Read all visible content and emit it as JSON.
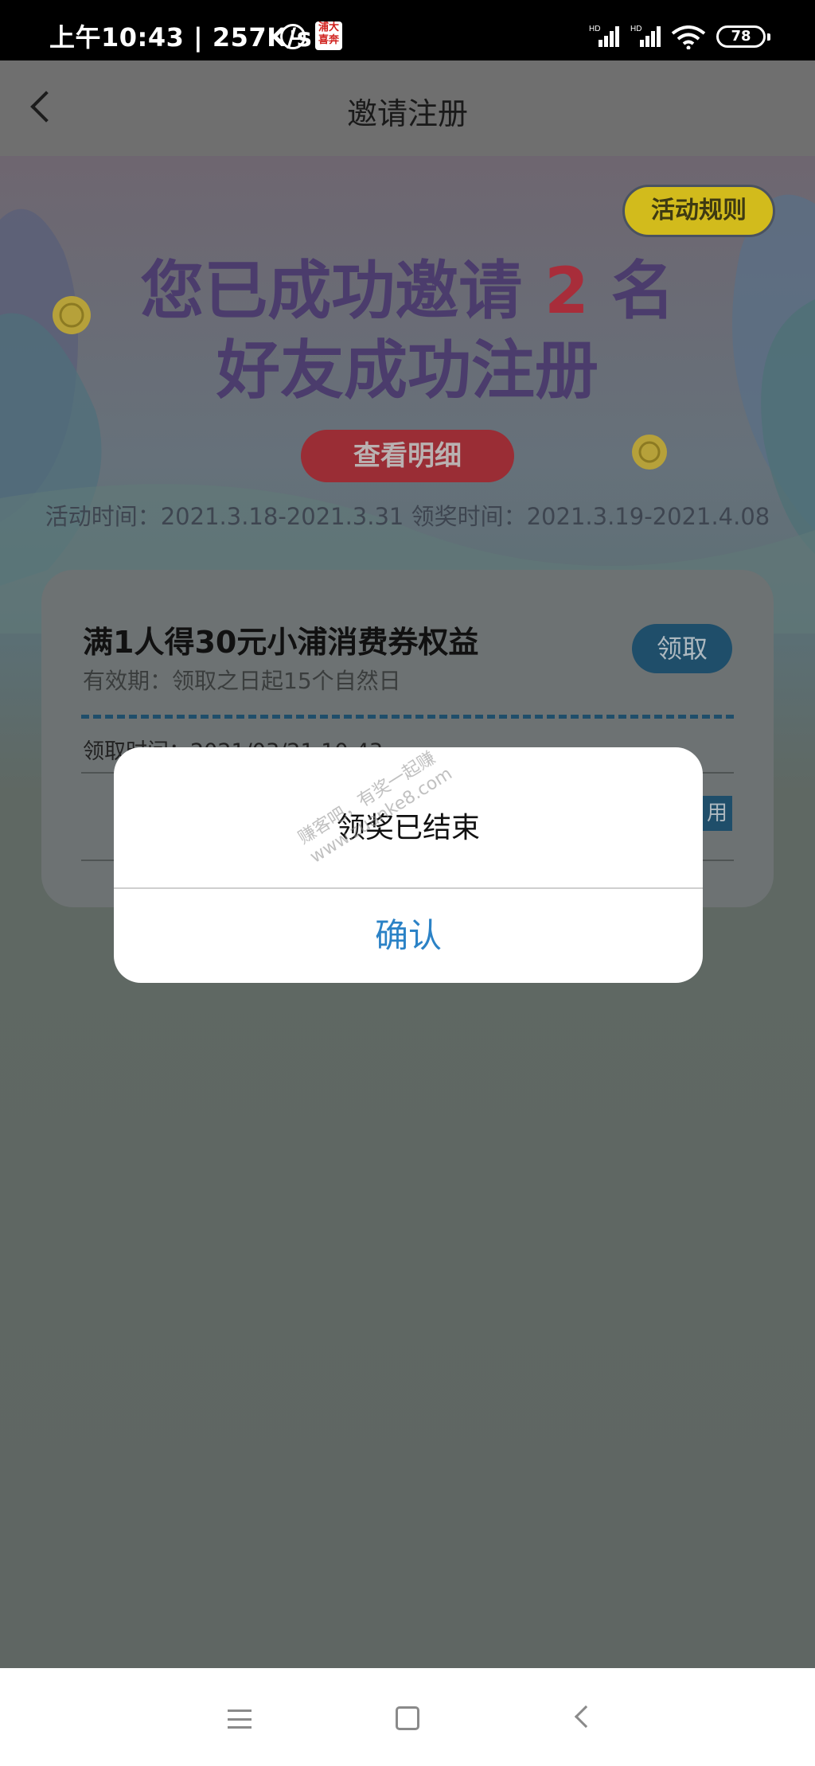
{
  "status_bar": {
    "time_speed": "上午10:43 | 257K/s",
    "app_badge": "浦大喜奔",
    "signal_label": "HD",
    "battery": "78"
  },
  "header": {
    "title": "邀请注册"
  },
  "banner": {
    "rules_button": "活动规则",
    "headline_line1_prefix": "您已成功邀请",
    "headline_count": "2",
    "headline_line1_suffix": "名",
    "headline_line2": "好友成功注册",
    "detail_button": "查看明细",
    "period_text": "活动时间：2021.3.18-2021.3.31 领奖时间：2021.3.19-2021.4.08"
  },
  "reward": {
    "title": "满1人得30元小浦消费券权益",
    "validity": "有效期：领取之日起15个自然日",
    "claim_button": "领取",
    "record_text": "领取时间：2021/03/21 10:43",
    "used_button": "用"
  },
  "dialog": {
    "message": "领奖已结束",
    "confirm_button": "确认"
  },
  "watermark": {
    "line1": "赚客吧，有奖一起赚",
    "line2": "www.zuanke8.com"
  },
  "colors": {
    "overlay": "#5f6663",
    "confirm_text": "#2b82c6",
    "claim_button": "#1f4e6a",
    "rules_button": "#d2bb1c"
  },
  "icons": {
    "back": "chevron-left-icon",
    "alarm": "alarm-clock-icon",
    "signal": "cellular-signal-icon",
    "wifi": "wifi-icon",
    "nav_menu": "menu-icon",
    "nav_home": "home-square-icon",
    "nav_back": "back-triangle-icon"
  }
}
